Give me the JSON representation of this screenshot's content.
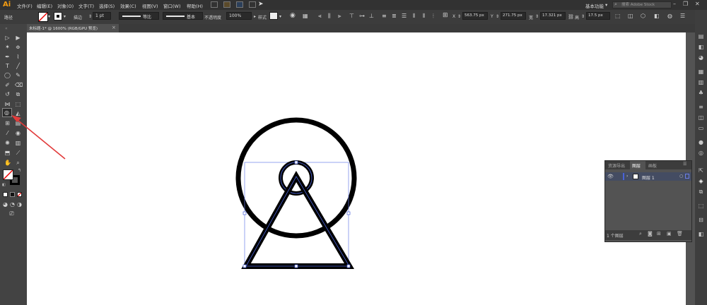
{
  "app": {
    "logo": "Ai"
  },
  "menu": [
    "文件(F)",
    "编辑(E)",
    "对象(O)",
    "文字(T)",
    "选择(S)",
    "效果(C)",
    "视图(V)",
    "窗口(W)",
    "帮助(H)"
  ],
  "workspace": {
    "label": "基本功能",
    "stock_placeholder": "搜索 Adobe Stock"
  },
  "control": {
    "object_type": "路径",
    "stroke_label": "描边",
    "stroke_weight": "1 pt",
    "profile_label": "等比",
    "brush_label": "基本",
    "opacity_label": "不透明度",
    "opacity_value": "100%",
    "style_label": "样式",
    "x_label": "X",
    "x_value": "563.75 px",
    "y_label": "Y",
    "y_value": "271.75 px",
    "w_label": "宽",
    "w_value": "17.321 px",
    "h_label": "高",
    "h_value": "17.5 px"
  },
  "document": {
    "tab_title": "未标题-1* @ 1600% (RGB/GPU 预览)",
    "close": "×"
  },
  "layers_panel": {
    "tabs": [
      "资源导出",
      "图层",
      "画板"
    ],
    "active_tab": "图层",
    "layer_name": "图层 1",
    "footer": "1 个图层"
  },
  "colors": {
    "accent": "#f39c12",
    "selection": "#4a63d8",
    "annotation_arrow": "#e23b3b"
  }
}
